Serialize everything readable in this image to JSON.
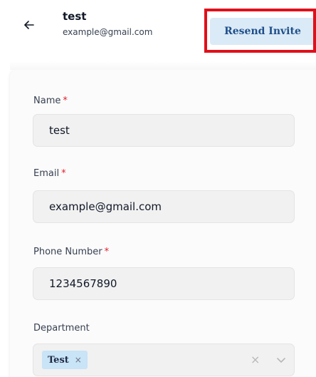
{
  "header": {
    "name": "test",
    "email": "example@gmail.com",
    "resend_label": "Resend Invite"
  },
  "form": {
    "name": {
      "label": "Name",
      "required_mark": "*",
      "value": "test"
    },
    "email": {
      "label": "Email",
      "required_mark": "*",
      "value": "example@gmail.com"
    },
    "phone": {
      "label": "Phone Number",
      "required_mark": "*",
      "value": "1234567890"
    },
    "department": {
      "label": "Department",
      "chips": [
        {
          "label": "Test",
          "remove_glyph": "×"
        }
      ],
      "clear_glyph": "×"
    }
  },
  "colors": {
    "highlight": "#e0101a",
    "resend_bg": "#dbeaf7",
    "resend_text": "#1e4f8a",
    "required": "#e11d2c",
    "chip_bg": "#c9e3f7"
  }
}
